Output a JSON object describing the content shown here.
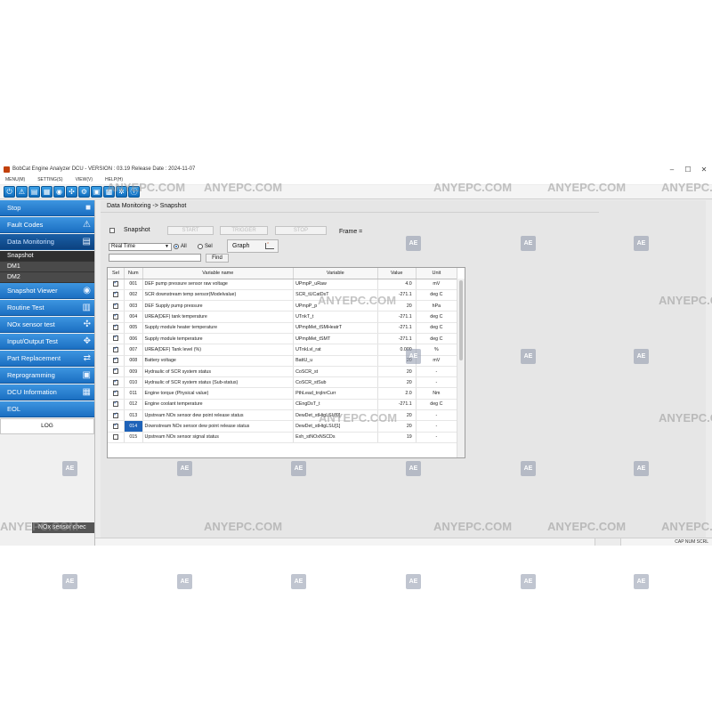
{
  "window": {
    "title": "BobCat Engine Analyzer DCU - VERSION : 03.19 Release Date : 2024-11-07",
    "controls": [
      "–",
      "☐",
      "✕"
    ]
  },
  "menu": [
    "MENU(M)",
    "SETTING(S)",
    "VIEW(V)",
    "HELP(H)"
  ],
  "toolbar": {
    "icons": [
      "power-icon",
      "warning-icon",
      "monitor-icon",
      "document-icon",
      "camera-icon",
      "network-icon",
      "settings-icon",
      "ecu-icon",
      "cpu-icon",
      "gear-icon",
      "info-icon"
    ],
    "glyphs": [
      "⏻",
      "⚠",
      "▤",
      "▦",
      "◉",
      "✣",
      "⚙",
      "▣",
      "▩",
      "✲",
      "ⓘ"
    ]
  },
  "sidebar": {
    "buttons_top": [
      {
        "label": "Stop",
        "icon": "stop-icon",
        "glyph": "■"
      },
      {
        "label": "Fault Codes",
        "icon": "warning-icon",
        "glyph": "⚠"
      },
      {
        "label": "Data Monitoring",
        "icon": "monitor-icon",
        "glyph": "▤"
      }
    ],
    "sub_items": [
      "Snapshot",
      "DM1",
      "DM2"
    ],
    "buttons_bottom": [
      {
        "label": "Snapshot Viewer",
        "icon": "camera-icon",
        "glyph": "◉"
      },
      {
        "label": "Routine Test",
        "icon": "routine-icon",
        "glyph": "▥"
      },
      {
        "label": "NOx sensor test",
        "icon": "sensor-icon",
        "glyph": "✣"
      },
      {
        "label": "Input/Output Test",
        "icon": "io-icon",
        "glyph": "✥"
      },
      {
        "label": "Part Replacement",
        "icon": "replace-icon",
        "glyph": "⇄"
      },
      {
        "label": "Reprogramming",
        "icon": "chip-icon",
        "glyph": "▣"
      },
      {
        "label": "DCU Information",
        "icon": "info-icon",
        "glyph": "▦"
      },
      {
        "label": "EOL",
        "icon": "eol-icon",
        "glyph": ""
      }
    ],
    "log_label": "LOG",
    "status_chip": "NOx sensor chec"
  },
  "main": {
    "breadcrumb": "Data Monitoring -> Snapshot",
    "snapshot_label": "Snapshot",
    "buttons": [
      "START",
      "TRIGGER",
      "STOP"
    ],
    "frame_label": "Frame =",
    "mode_select": "Real Time",
    "radio_all": "All",
    "radio_sel": "Sel",
    "graph_label": "Graph",
    "find_label": "Find",
    "search_value": ""
  },
  "table": {
    "headers": [
      "Sel",
      "Num",
      "Variable name",
      "Variable",
      "Value",
      "Unit"
    ],
    "rows": [
      {
        "sel": true,
        "num": "001",
        "name": "DEF pump pressure sensor raw voltage",
        "var": "UPmpP_uRaw",
        "value": "4.0",
        "unit": "mV"
      },
      {
        "sel": true,
        "num": "002",
        "name": "SCR downstream temp sensor(Modelvalue)",
        "var": "SCR_tUCatDsT",
        "value": "-271.1",
        "unit": "deg C"
      },
      {
        "sel": true,
        "num": "003",
        "name": "DEF Supply pump pressure",
        "var": "UPmpP_p",
        "value": "20",
        "unit": "hPa"
      },
      {
        "sel": true,
        "num": "004",
        "name": "UREA(DEF) tank temperature",
        "var": "UTnkT_t",
        "value": "-271.1",
        "unit": "deg C"
      },
      {
        "sel": true,
        "num": "005",
        "name": "Supply module heater temperature",
        "var": "UPmpMet_tSMHeatrT",
        "value": "-271.1",
        "unit": "deg C"
      },
      {
        "sel": true,
        "num": "006",
        "name": "Supply module temperature",
        "var": "UPmpMet_tSMT",
        "value": "-271.1",
        "unit": "deg C"
      },
      {
        "sel": true,
        "num": "007",
        "name": "UREA(DEF) Tank level (%)",
        "var": "UTnkLvl_rat",
        "value": "0.000",
        "unit": "%"
      },
      {
        "sel": true,
        "num": "008",
        "name": "Battery voltage",
        "var": "BattU_u",
        "value": "20",
        "unit": "mV"
      },
      {
        "sel": true,
        "num": "009",
        "name": "Hydraulic of SCR system status",
        "var": "CoSCR_st",
        "value": "20",
        "unit": "-"
      },
      {
        "sel": true,
        "num": "010",
        "name": "Hydraulic of SCR system status (Sub-status)",
        "var": "CoSCR_stSub",
        "value": "20",
        "unit": "-"
      },
      {
        "sel": true,
        "num": "011",
        "name": "Engine torque (Physical value)",
        "var": "PthLead_trqInrCurr",
        "value": "2.0",
        "unit": "Nm"
      },
      {
        "sel": true,
        "num": "012",
        "name": "Engine coolant temperature",
        "var": "CEngDsT_t",
        "value": "-271.1",
        "unit": "deg C"
      },
      {
        "sel": true,
        "num": "013",
        "name": "Upstream NOx sensor dew point release status",
        "var": "DewDet_stHtgLSU[0]",
        "value": "20",
        "unit": "-"
      },
      {
        "sel": true,
        "num": "014",
        "name": "Downstream NOx sensor dew point release status",
        "var": "DewDet_stHtgLSU[1]",
        "value": "20",
        "unit": "-"
      },
      {
        "sel": false,
        "num": "015",
        "name": "Upstream NOx sensor signal status",
        "var": "Exh_stNOxNSCDs",
        "value": "19",
        "unit": "-"
      }
    ],
    "highlighted_row": 13
  },
  "statusbar": {
    "caps": "CAP NUM SCRL"
  },
  "watermark": {
    "text": "ANYEPC.COM",
    "logo": "AE"
  }
}
